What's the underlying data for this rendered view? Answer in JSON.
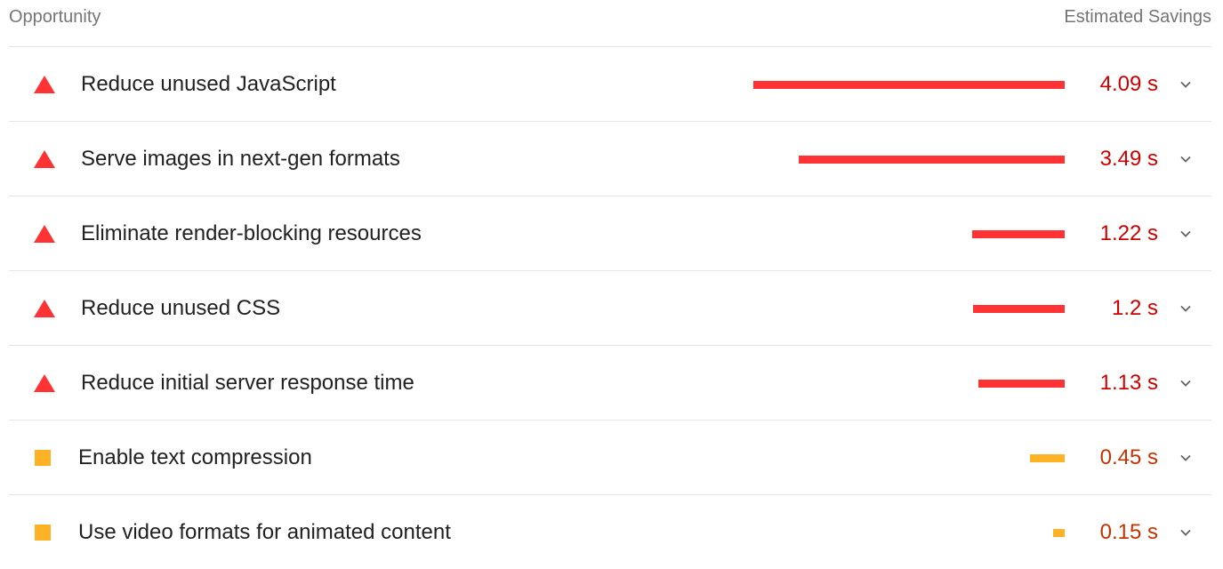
{
  "header": {
    "opportunity_label": "Opportunity",
    "savings_label": "Estimated Savings"
  },
  "colors": {
    "fail": "#ff3333",
    "fail_text": "#cc0000",
    "average": "#ffa400",
    "average_text": "#c33300"
  },
  "max_savings_s": 4.09,
  "rows": [
    {
      "status": "fail",
      "icon": "triangle-warning-icon",
      "title": "Reduce unused JavaScript",
      "savings": "4.09 s",
      "savings_value": 4.09
    },
    {
      "status": "fail",
      "icon": "triangle-warning-icon",
      "title": "Serve images in next-gen formats",
      "savings": "3.49 s",
      "savings_value": 3.49
    },
    {
      "status": "fail",
      "icon": "triangle-warning-icon",
      "title": "Eliminate render-blocking resources",
      "savings": "1.22 s",
      "savings_value": 1.22
    },
    {
      "status": "fail",
      "icon": "triangle-warning-icon",
      "title": "Reduce unused CSS",
      "savings": "1.2 s",
      "savings_value": 1.2
    },
    {
      "status": "fail",
      "icon": "triangle-warning-icon",
      "title": "Reduce initial server response time",
      "savings": "1.13 s",
      "savings_value": 1.13
    },
    {
      "status": "average",
      "icon": "square-average-icon",
      "title": "Enable text compression",
      "savings": "0.45 s",
      "savings_value": 0.45
    },
    {
      "status": "average",
      "icon": "square-average-icon",
      "title": "Use video formats for animated content",
      "savings": "0.15 s",
      "savings_value": 0.15
    }
  ]
}
